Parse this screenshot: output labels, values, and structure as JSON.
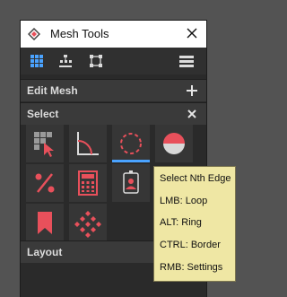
{
  "window": {
    "title": "Mesh Tools",
    "icon": "mesh-tools-logo-icon",
    "close_icon": "close-icon"
  },
  "toolbar": {
    "buttons": [
      {
        "icon": "grid-icon",
        "active": true
      },
      {
        "icon": "hierarchy-icon",
        "active": false
      },
      {
        "icon": "bounding-box-icon",
        "active": false
      },
      {
        "icon": "menu-icon",
        "active": false
      }
    ]
  },
  "sections": {
    "edit_mesh": {
      "label": "Edit Mesh",
      "action_icon": "plus-icon"
    },
    "select": {
      "label": "Select",
      "action_icon": "close-icon"
    },
    "layout": {
      "label": "Layout"
    }
  },
  "select_tools": [
    {
      "icon": "select-tiles-cursor-icon"
    },
    {
      "icon": "angle-select-icon"
    },
    {
      "icon": "dashed-circle-select-icon",
      "active": true
    },
    {
      "icon": "half-circle-select-icon"
    },
    {
      "icon": "percent-select-icon"
    },
    {
      "icon": "calculator-icon"
    },
    {
      "icon": "id-badge-icon"
    },
    {
      "icon": "bookmark-icon"
    },
    {
      "icon": "checker-pattern-icon"
    }
  ],
  "tooltip": {
    "title": "Select Nth Edge",
    "lines": [
      "LMB: Loop",
      "ALT: Ring",
      "CTRL: Border",
      "RMB: Settings"
    ]
  },
  "colors": {
    "accent": "#4aa3ff",
    "icon_red": "#e8505b",
    "tooltip_bg": "#efe7a4"
  }
}
